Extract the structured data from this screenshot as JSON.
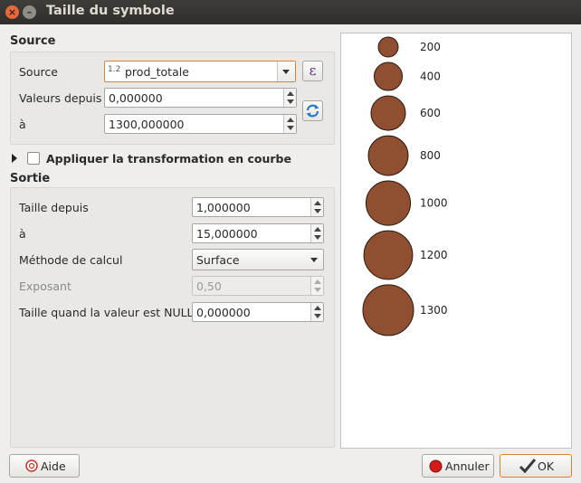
{
  "window": {
    "title": "Taille du symbole"
  },
  "source_section": {
    "title": "Source",
    "source_label": "Source",
    "source_type_badge": "1.2",
    "source_value": "prod_totale",
    "values_from_label": "Valeurs depuis",
    "values_from": "0,000000",
    "values_to_label": "à",
    "values_to": "1300,000000"
  },
  "curve_transform": {
    "label": "Appliquer la transformation en courbe",
    "checked": false
  },
  "output_section": {
    "title": "Sortie",
    "size_from_label": "Taille depuis",
    "size_from": "1,000000",
    "size_to_label": "à",
    "size_to": "15,000000",
    "method_label": "Méthode de calcul",
    "method_value": "Surface",
    "exponent_label": "Exposant",
    "exponent_value": "0,50",
    "null_size_label": "Taille quand la valeur est NULL",
    "null_size_value": "0,000000"
  },
  "preview": {
    "fill_color": "#8f4f30",
    "stroke_color": "#2a1a12",
    "items": [
      {
        "label": "200",
        "diameter_ratio": 0.3922
      },
      {
        "label": "400",
        "diameter_ratio": 0.5547
      },
      {
        "label": "600",
        "diameter_ratio": 0.6794
      },
      {
        "label": "800",
        "diameter_ratio": 0.7845
      },
      {
        "label": "1000",
        "diameter_ratio": 0.8771
      },
      {
        "label": "1200",
        "diameter_ratio": 0.9608
      },
      {
        "label": "1300",
        "diameter_ratio": 1.0
      }
    ]
  },
  "buttons": {
    "help": "Aide",
    "cancel": "Annuler",
    "ok": "OK"
  }
}
